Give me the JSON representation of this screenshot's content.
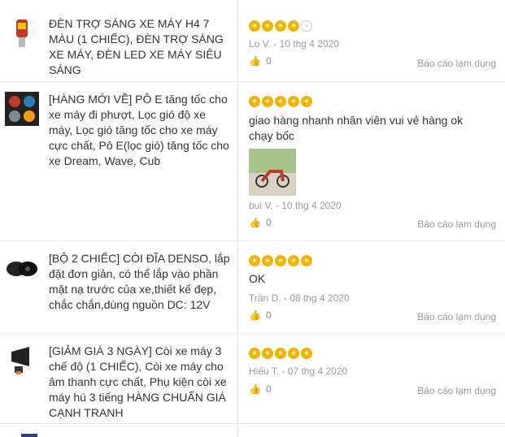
{
  "reviews": [
    {
      "product": "ĐÈN TRỢ SÁNG XE MÁY H4 7 MÀU (1 CHIẾC), ĐÈN TRỢ SÁNG XE MÁY, ĐÈN LED XE MÁY SIÊU SÁNG",
      "rating": 4,
      "comment": "",
      "author_date": "Lo V. - 10 thg 4 2020",
      "likes": "0",
      "report": "Báo cáo lạm dụng"
    },
    {
      "product": "[HÀNG MỚI VỀ] PÔ E tăng tốc cho xe máy đi phượt, Lọc gió độ xe máy, Lọc gió tăng tốc cho xe máy cực chất, Pô E(lọc gió) tăng tốc cho xe Dream, Wave, Cub",
      "rating": 5,
      "comment": "giao hàng nhanh nhân viên vui vẻ hàng ok chạy bốc",
      "author_date": "bui V. - 10 thg 4 2020",
      "likes": "0",
      "report": "Báo cáo lạm dụng"
    },
    {
      "product": "[BỘ 2 CHIẾC] CÒI ĐĨA DENSO, lắp đặt đơn giản, có thể lắp vào phần mặt nạ trước của xe,thiết kế đẹp, chắc chắn,dùng nguồn DC: 12V",
      "rating": 5,
      "comment": "OK",
      "author_date": "Trần D. - 08 thg 4 2020",
      "likes": "0",
      "report": "Báo cáo lạm dụng"
    },
    {
      "product": "[GIẢM GIÁ 3 NGÀY] Còi xe máy 3 chế độ (1 CHIẾC), Còi xe máy cho âm thanh cực chất, Phụ kiện còi xe máy hú 3 tiếng HÀNG CHUẨN GIÁ CẠNH TRANH",
      "rating": 5,
      "comment": "",
      "author_date": "Hiếu T. - 07 thg 4 2020",
      "likes": "0",
      "report": "Báo cáo lạm dụng"
    }
  ],
  "colors": {
    "star": "#f5b301",
    "divider": "#e8e8e8",
    "muted": "#999999"
  }
}
